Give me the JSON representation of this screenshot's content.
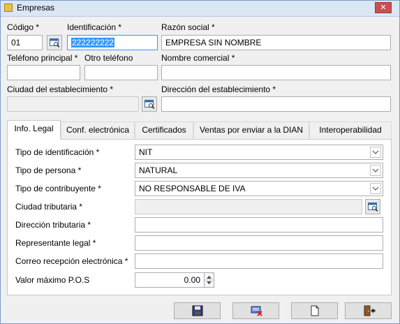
{
  "window": {
    "title": "Empresas",
    "close_label": "✕"
  },
  "header": {
    "codigo": {
      "label": "Código *",
      "value": "01"
    },
    "identificacion": {
      "label": "Identificación *",
      "value": "222222222"
    },
    "razon_social": {
      "label": "Razón social *",
      "value": "EMPRESA SIN NOMBRE"
    },
    "telefono_principal": {
      "label": "Teléfono principal *",
      "value": ""
    },
    "otro_telefono": {
      "label": "Otro teléfono",
      "value": ""
    },
    "nombre_comercial": {
      "label": "Nombre comercial *",
      "value": ""
    },
    "ciudad_establecimiento": {
      "label": "Ciudad del establecimiento *",
      "value": ""
    },
    "direccion_establecimiento": {
      "label": "Dirección del establecimiento *",
      "value": ""
    }
  },
  "tabs": [
    {
      "label": "Info. Legal",
      "active": true
    },
    {
      "label": "Conf. electrónica",
      "active": false
    },
    {
      "label": "Certificados",
      "active": false
    },
    {
      "label": "Ventas por enviar a la DIAN",
      "active": false
    },
    {
      "label": "Interoperabilidad",
      "active": false
    }
  ],
  "legal": {
    "tipo_identificacion": {
      "label": "Tipo de identificación *",
      "value": "NIT"
    },
    "tipo_persona": {
      "label": "Tipo de persona *",
      "value": "NATURAL"
    },
    "tipo_contribuyente": {
      "label": "Tipo de contribuyente *",
      "value": "NO RESPONSABLE DE IVA"
    },
    "ciudad_tributaria": {
      "label": "Ciudad tributaria *",
      "value": ""
    },
    "direccion_tributaria": {
      "label": "Dirección tributaria *",
      "value": ""
    },
    "representante_legal": {
      "label": "Representante legal *",
      "value": ""
    },
    "correo_recepcion": {
      "label": "Correo recepción electrónica *",
      "value": ""
    },
    "valor_maximo_pos": {
      "label": "Valor máximo P.O.S",
      "value": "0.00"
    }
  },
  "toolbar": {
    "buttons": [
      {
        "icon": "save-icon"
      },
      {
        "icon": "delete-icon"
      },
      {
        "icon": "new-document-icon"
      },
      {
        "icon": "exit-icon"
      }
    ]
  }
}
